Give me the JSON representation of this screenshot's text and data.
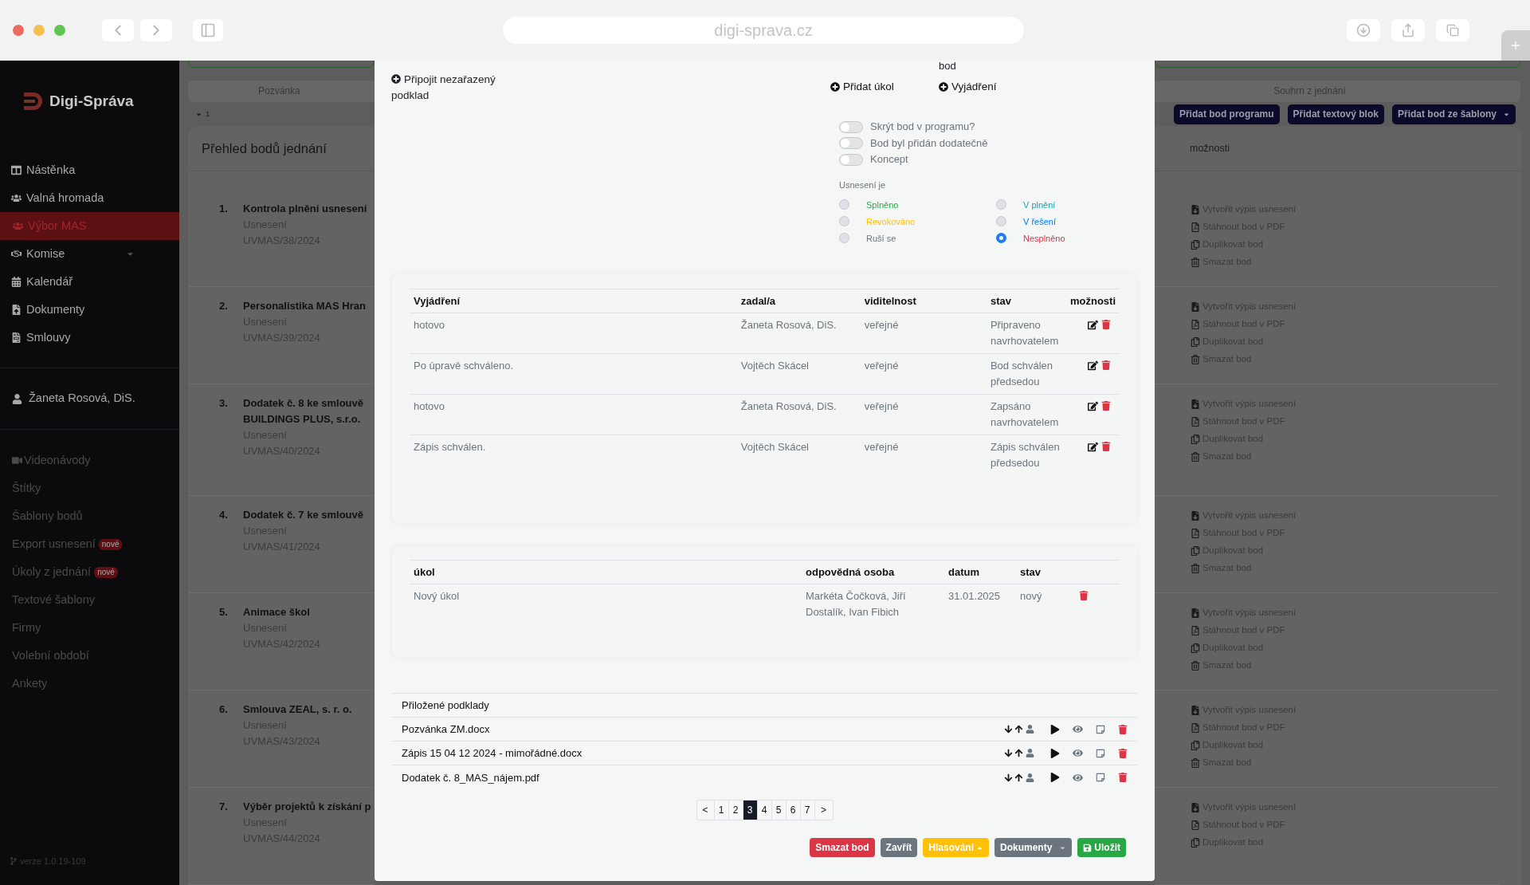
{
  "browser": {
    "url": "digi-sprava.cz"
  },
  "sidebar": {
    "logo": "Digi-Správa",
    "nav": [
      {
        "label": "Nástěnka",
        "selected": false,
        "has_submenu": false
      },
      {
        "label": "Valná hromada",
        "selected": false,
        "has_submenu": false
      },
      {
        "label": "Výbor MAS",
        "selected": true,
        "has_submenu": false
      },
      {
        "label": "Komise",
        "selected": false,
        "has_submenu": true
      },
      {
        "label": "Kalendář",
        "selected": false,
        "has_submenu": false
      },
      {
        "label": "Dokumenty",
        "selected": false,
        "has_submenu": false
      },
      {
        "label": "Smlouvy",
        "selected": false,
        "has_submenu": false
      }
    ],
    "user": "Žaneta Rosová, DiS.",
    "secondary": [
      {
        "label": "Videonávody"
      },
      {
        "label": "Štítky"
      },
      {
        "label": "Šablony bodů"
      },
      {
        "label": "Export usnesení",
        "badge": "nové"
      },
      {
        "label": "Úkoly z jednání",
        "badge": "nové"
      },
      {
        "label": "Textové šablony"
      },
      {
        "label": "Firmy"
      },
      {
        "label": "Volební období"
      },
      {
        "label": "Ankety"
      }
    ],
    "version": "verze 1.0.19-109"
  },
  "meeting": {
    "tab_left": "Pozvánka",
    "tab_right": "Souhrn z jednání",
    "counter": "1",
    "card_title": "Přehled bodů jednání",
    "buttons": [
      {
        "label": "Přidat bod programu",
        "dropdown": false
      },
      {
        "label": "Přidat textový blok",
        "dropdown": false
      },
      {
        "label": "Přidat bod ze šablony",
        "dropdown": true
      }
    ],
    "options_column": "možnosti",
    "items": [
      {
        "number": "1.",
        "title_lines": [
          "Kontrola plnění usnesení"
        ],
        "type": "Usnesení",
        "code": "UVMAS/38/2024",
        "actions": [
          "Vytvořit výpis usnesení",
          "Stáhnout bod v PDF",
          "Duplikovat bod",
          "Smazat bod"
        ]
      },
      {
        "number": "2.",
        "title_lines": [
          "Personalistika MAS Hran"
        ],
        "type": "Usnesení",
        "code": "UVMAS/39/2024",
        "actions": [
          "Vytvořit výpis usnesení",
          "Stáhnout bod v PDF",
          "Duplikovat bod",
          "Smazat bod"
        ]
      },
      {
        "number": "3.",
        "title_lines": [
          "Dodatek č. 8 ke smlouvě",
          "BUILDINGS PLUS, s.r.o."
        ],
        "type": "Usnesení",
        "code": "UVMAS/40/2024",
        "actions": [
          "Vytvořit výpis usnesení",
          "Stáhnout bod v PDF",
          "Duplikovat bod",
          "Smazat bod"
        ]
      },
      {
        "number": "4.",
        "title_lines": [
          "Dodatek č. 7 ke smlouvě"
        ],
        "type": "Usnesení",
        "code": "UVMAS/41/2024",
        "actions": [
          "Vytvořit výpis usnesení",
          "Stáhnout bod v PDF",
          "Duplikovat bod",
          "Smazat bod"
        ]
      },
      {
        "number": "5.",
        "title_lines": [
          "Animace škol"
        ],
        "type": "Usnesení",
        "code": "UVMAS/42/2024",
        "actions": [
          "Vytvořit výpis usnesení",
          "Stáhnout bod v PDF",
          "Duplikovat bod",
          "Smazat bod"
        ]
      },
      {
        "number": "6.",
        "title_lines": [
          "Smlouva ZEAL, s. r. o."
        ],
        "type": "Usnesení",
        "code": "UVMAS/43/2024",
        "actions": [
          "Vytvořit výpis usnesení",
          "Stáhnout bod v PDF",
          "Duplikovat bod",
          "Smazat bod"
        ]
      },
      {
        "number": "7.",
        "title_lines": [
          "Výběr projektů k získání p"
        ],
        "type": "Usnesení",
        "code": "UVMAS/44/2024",
        "actions": [
          "Vytvořit výpis usnesení",
          "Stáhnout bod v PDF",
          "Duplikovat bod"
        ]
      }
    ]
  },
  "modal": {
    "top_cut": "bod",
    "attach_link": "Připojit nezařazený podklad",
    "add_task": "Přidat úkol",
    "add_statement": "Vyjádření",
    "switches": [
      {
        "label": "Skrýt bod v programu?",
        "on": false
      },
      {
        "label": "Bod byl přidán dodatečně",
        "on": false
      },
      {
        "label": "Koncept",
        "on": false
      }
    ],
    "resolution_label": "Usnesení je",
    "resolution_options": [
      {
        "label": "Splněno",
        "color": "#28a745",
        "selected": false
      },
      {
        "label": "V plnění",
        "color": "#17a2b8",
        "selected": false
      },
      {
        "label": "Revokováno",
        "color": "#ffc107",
        "selected": false
      },
      {
        "label": "V řešení",
        "color": "#007bff",
        "selected": false
      },
      {
        "label": "Ruší se",
        "color": "#6c757d",
        "selected": false
      },
      {
        "label": "Nesplněno",
        "color": "#dc3545",
        "selected": true
      }
    ],
    "statements": {
      "columns": [
        "Vyjádření",
        "zadal/a",
        "viditelnost",
        "stav",
        "možnosti"
      ],
      "rows": [
        {
          "text": "hotovo",
          "author": "Žaneta Rosová, DiS.",
          "visibility": "veřejné",
          "status": "Připraveno navrhovatelem"
        },
        {
          "text": "Po úpravě schváleno.",
          "author": "Vojtěch Skácel",
          "visibility": "veřejné",
          "status": "Bod schválen předsedou"
        },
        {
          "text": "hotovo",
          "author": "Žaneta Rosová, DiS.",
          "visibility": "veřejné",
          "status": "Zapsáno navrhovatelem"
        },
        {
          "text": "Zápis schválen.",
          "author": "Vojtěch Skácel",
          "visibility": "veřejné",
          "status": "Zápis schválen předsedou"
        }
      ]
    },
    "tasks": {
      "columns": [
        "úkol",
        "odpovědná osoba",
        "datum",
        "stav"
      ],
      "rows": [
        {
          "task": "Nový úkol",
          "people": "Markéta Čočková, Jiří Dostalík, Ivan Fibich",
          "date": "31.01.2025",
          "status": "nový"
        }
      ]
    },
    "attachments": {
      "title": "Přiložené podklady",
      "files": [
        "Pozvánka ZM.docx",
        "Zápis 15 04 12 2024 - mimořádné.docx",
        "Dodatek č. 8_MAS_nájem.pdf"
      ]
    },
    "pagination": {
      "prev": "<",
      "next": ">",
      "pages": [
        {
          "label": "1",
          "selected": false
        },
        {
          "label": "2",
          "selected": false
        },
        {
          "label": "3",
          "selected": true
        },
        {
          "label": "4",
          "selected": false
        },
        {
          "label": "5",
          "selected": false
        },
        {
          "label": "6",
          "selected": false
        },
        {
          "label": "7",
          "selected": false
        }
      ]
    },
    "actions": [
      {
        "label": "Smazat bod",
        "kind": "danger"
      },
      {
        "label": "Zavřít",
        "kind": "secondary"
      },
      {
        "label": "Hlasování",
        "kind": "warning"
      },
      {
        "label": "Dokumenty",
        "kind": "secondary"
      },
      {
        "label": "Uložit",
        "kind": "success"
      }
    ]
  }
}
